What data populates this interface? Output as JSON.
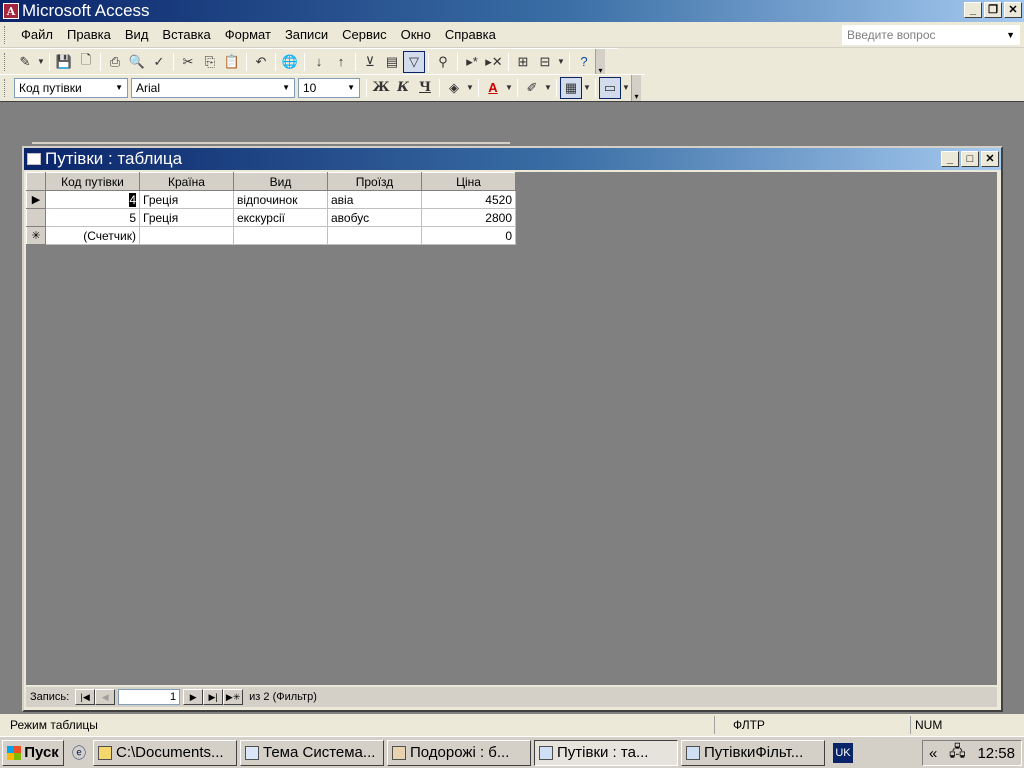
{
  "app": {
    "title": "Microsoft Access",
    "icon": "access-key-icon"
  },
  "menu": {
    "items": [
      "Файл",
      "Правка",
      "Вид",
      "Вставка",
      "Формат",
      "Записи",
      "Сервис",
      "Окно",
      "Справка"
    ],
    "ask_placeholder": "Введите вопрос"
  },
  "format_toolbar": {
    "field_select": "Код путівки",
    "font": "Arial",
    "size": "10",
    "bold": "Ж",
    "italic": "К",
    "underline": "Ч"
  },
  "child_window": {
    "title": "Путівки : таблица",
    "columns": [
      "Код путівки",
      "Країна",
      "Вид",
      "Проїзд",
      "Ціна"
    ],
    "rows": [
      {
        "code": "4",
        "country": "Греція",
        "kind": "відпочинок",
        "transport": "авіа",
        "price": "4520"
      },
      {
        "code": "5",
        "country": "Греція",
        "kind": "екскурсії",
        "transport": "авобус",
        "price": "2800"
      }
    ],
    "new_row": {
      "code": "(Счетчик)",
      "price": "0"
    }
  },
  "navigation": {
    "label": "Запись:",
    "current": "1",
    "of_text": "из  2 (Фильтр)"
  },
  "status": {
    "mode": "Режим таблицы",
    "filter": "ФЛТР",
    "num": "NUM"
  },
  "taskbar": {
    "start": "Пуск",
    "tasks": [
      "C:\\Documents...",
      "Тема Система...",
      "Подорожі : б...",
      "Путівки : та...",
      "ПутівкиФільт..."
    ],
    "lang": "UK",
    "clock": "12:58"
  }
}
